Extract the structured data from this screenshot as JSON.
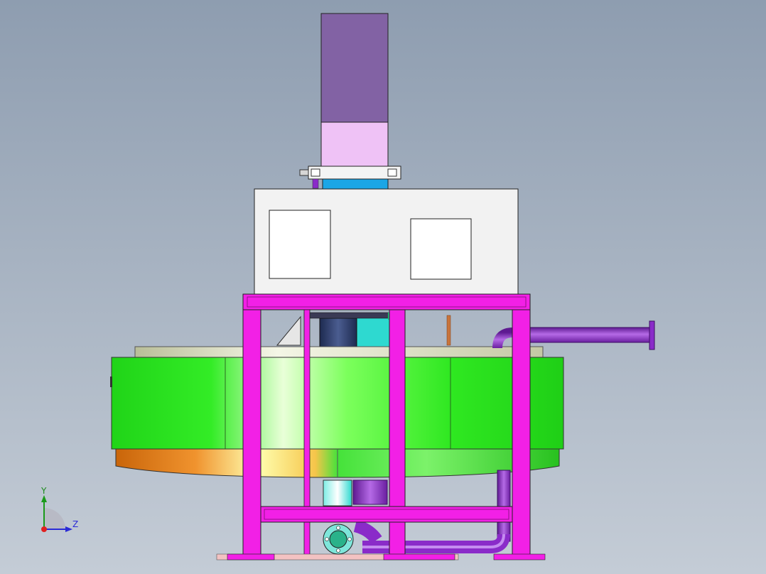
{
  "viewport": {
    "background_top": "#8e9db0",
    "background_bottom": "#c4ccd6"
  },
  "model": {
    "colors": {
      "motor_top": "#8262a4",
      "motor_bottom": "#efc2f6",
      "coupling_blue": "#1ba6e6",
      "cabinet": "#f2f2f2",
      "frame_magenta": "#f220e6",
      "drum_green": "#2fe821",
      "drum_orange": "#e57412",
      "pipe_purple": "#8a2bc9",
      "pipe_copper": "#c8743c",
      "teal": "#2ed9d0",
      "dark_blue": "#2a3a6a"
    }
  },
  "triad": {
    "y_label": "Y",
    "z_label": "Z",
    "y_icon": "y-axis-arrow-icon",
    "z_icon": "z-axis-arrow-icon",
    "origin_icon": "origin-dot-icon"
  }
}
